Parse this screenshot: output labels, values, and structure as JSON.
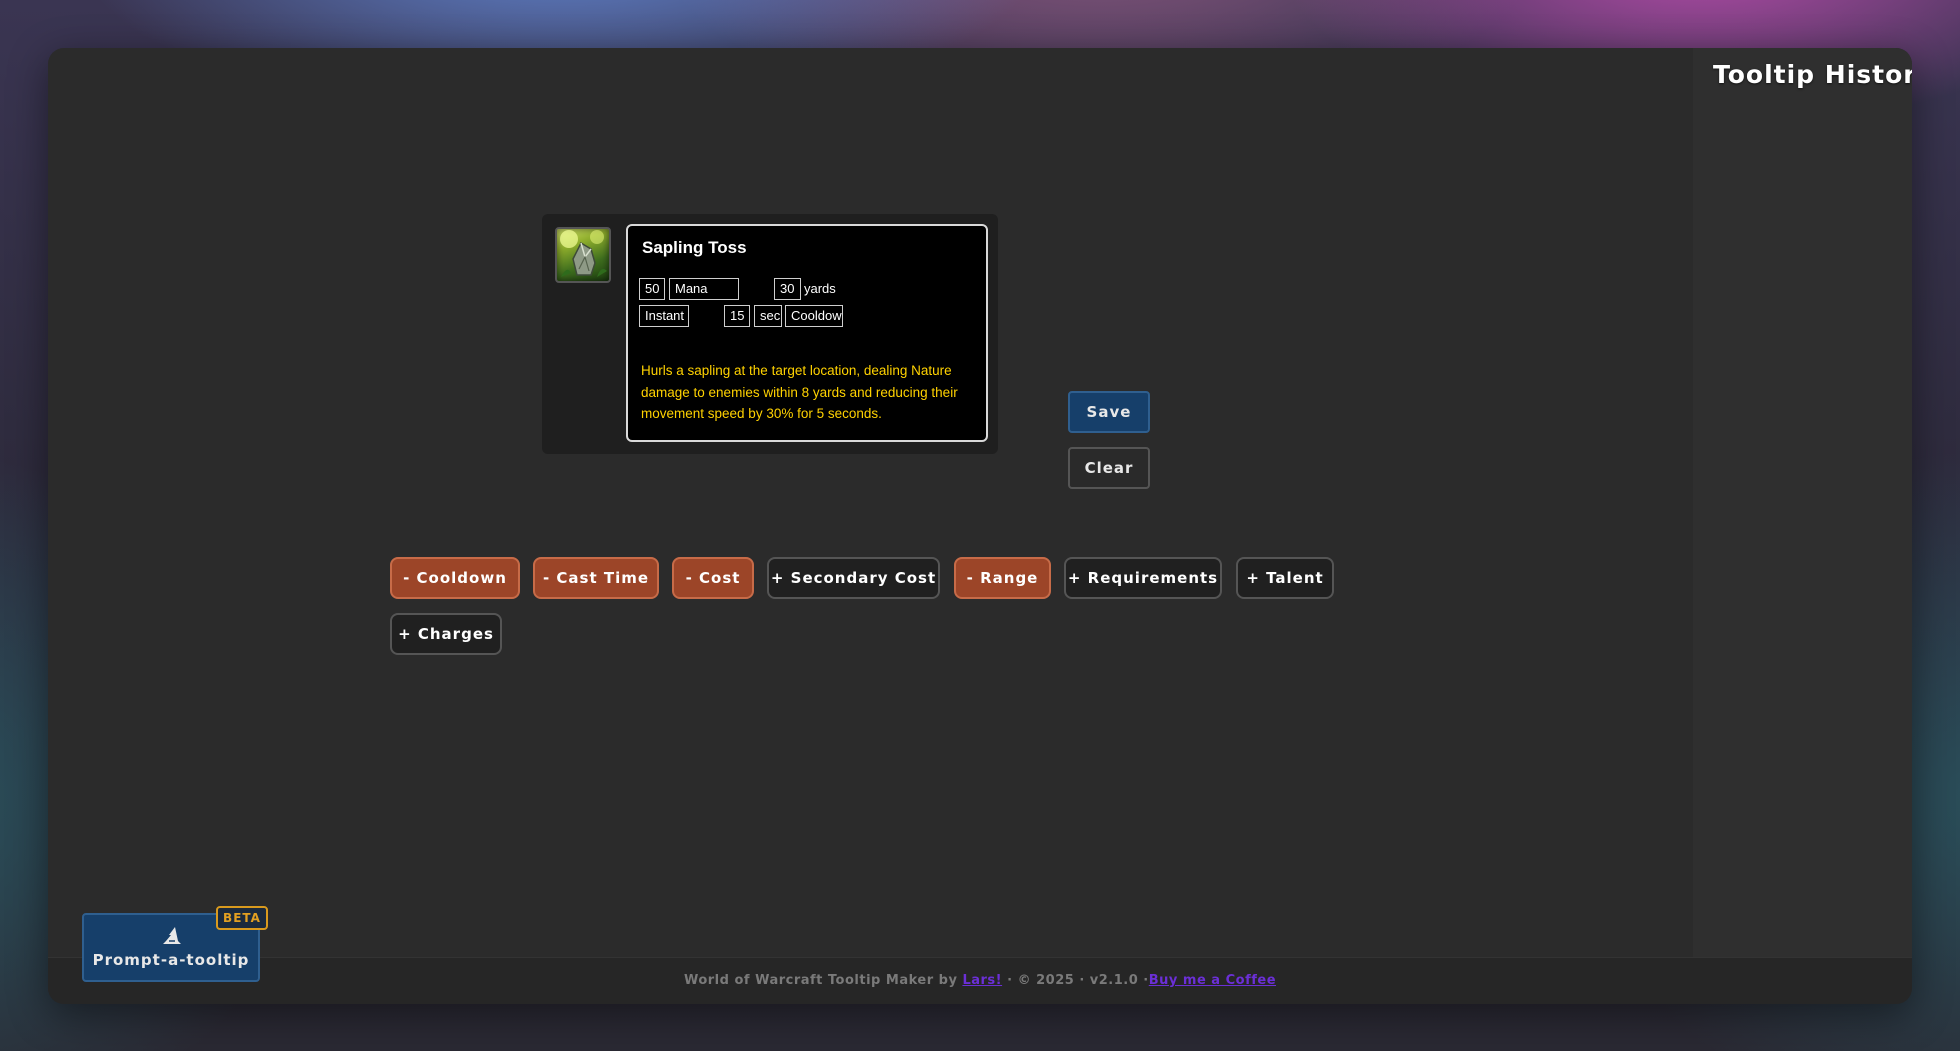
{
  "sidebar": {
    "title": "Tooltip History"
  },
  "tooltip": {
    "icon": "sapling-toss-spell-icon",
    "name": "Sapling Toss",
    "cost_amount": "50",
    "cost_resource": "Mana",
    "range_value": "30",
    "range_unit": "yards",
    "cast_time": "Instant",
    "cooldown_value": "15",
    "cooldown_unit": "sec",
    "cooldown_label": "Cooldown",
    "description": "Hurls a sapling at the target location, dealing Nature damage to enemies within 8 yards and reducing their movement speed by 30% for 5 seconds.",
    "description_color": "#ffd200"
  },
  "actions": {
    "save": "Save",
    "clear": "Clear"
  },
  "toggles": [
    {
      "label": "- Cooldown",
      "active": true
    },
    {
      "label": "- Cast Time",
      "active": true
    },
    {
      "label": "- Cost",
      "active": true
    },
    {
      "label": "+ Secondary Cost",
      "active": false
    },
    {
      "label": "- Range",
      "active": true
    },
    {
      "label": "+ Requirements",
      "active": false
    },
    {
      "label": "+ Talent",
      "active": false
    },
    {
      "label": "+ Charges",
      "active": false
    }
  ],
  "prompt": {
    "label": "Prompt-a-tooltip",
    "badge": "BETA",
    "icon": "wizard-hat-icon"
  },
  "footer": {
    "prefix": "World of Warcraft Tooltip Maker by",
    "author": "Lars!",
    "middle": "· © 2025 · v2.1.0 ·",
    "coffee": "Buy me a Coffee"
  },
  "colors": {
    "accent_blue": "#163f6a",
    "toggle_active": "#9c4528",
    "toggle_inactive": "#202020",
    "beta": "#e3a021",
    "link": "#6b2fd6"
  }
}
